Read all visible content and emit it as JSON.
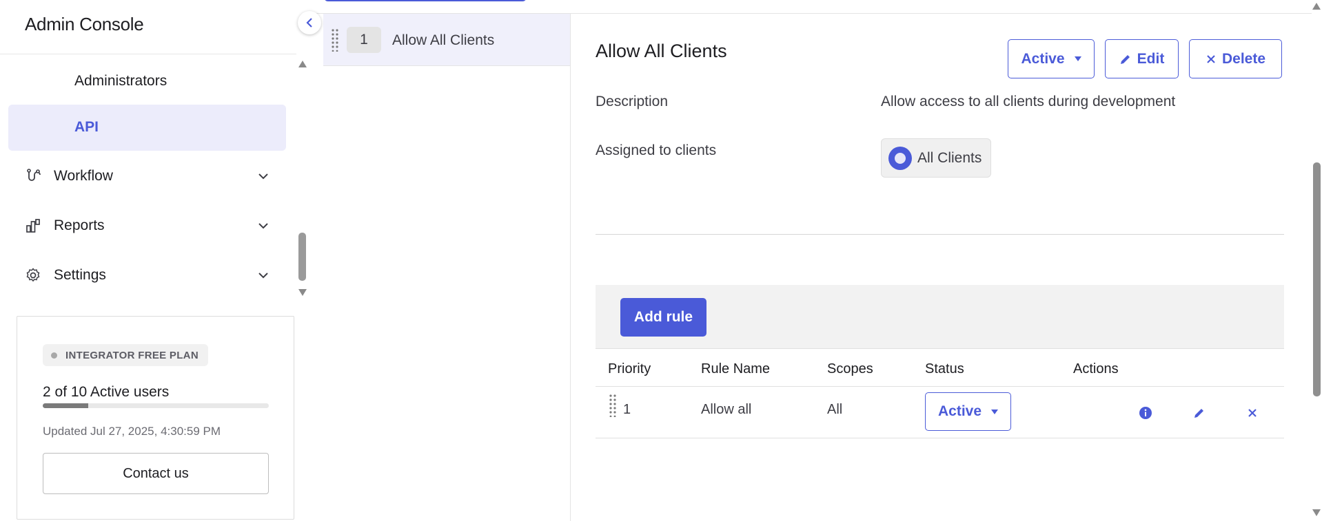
{
  "app": {
    "title": "Admin Console"
  },
  "sidebar": {
    "items": [
      {
        "label": "Administrators"
      },
      {
        "label": "API"
      },
      {
        "label": "Workflow",
        "icon": "workflow-icon"
      },
      {
        "label": "Reports",
        "icon": "reports-icon"
      },
      {
        "label": "Settings",
        "icon": "gear-icon"
      }
    ],
    "active_item": "API"
  },
  "plan": {
    "badge": "INTEGRATOR FREE PLAN",
    "users": "2 of 10 Active users",
    "usage_fraction": 0.2,
    "updated": "Updated Jul 27, 2025, 4:30:59 PM",
    "contact_label": "Contact us"
  },
  "policy_list": {
    "items": [
      {
        "priority": "1",
        "name": "Allow All Clients"
      }
    ]
  },
  "detail": {
    "title": "Allow All Clients",
    "status_label": "Active",
    "edit_label": "Edit",
    "delete_label": "Delete",
    "description_label": "Description",
    "description_value": "Allow access to all clients during development",
    "assigned_label": "Assigned to clients",
    "assigned_value": "All Clients"
  },
  "rules": {
    "add_rule_label": "Add rule",
    "columns": [
      "Priority",
      "Rule Name",
      "Scopes",
      "Status",
      "Actions"
    ],
    "rows": [
      {
        "priority": "1",
        "name": "Allow all",
        "scopes": "All",
        "status": "Active"
      }
    ]
  },
  "colors": {
    "accent": "#4a5ad8",
    "active_nav_bg": "#ececfb"
  }
}
